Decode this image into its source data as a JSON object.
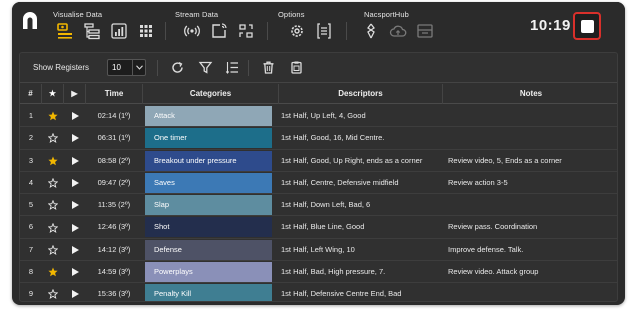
{
  "toolbar": {
    "groups": {
      "visualise": "Visualise Data",
      "stream": "Stream Data",
      "options": "Options",
      "hub": "NacsportHub"
    },
    "clock": "10:19",
    "icons": {
      "visualise": [
        "register-list-icon",
        "tree-list-icon",
        "chart-icon",
        "grid-icon"
      ],
      "stream": [
        "broadcast-icon",
        "stream-export-icon",
        "connect-icon"
      ],
      "options": [
        "settings-icon",
        "sliders-icon"
      ],
      "hub": [
        "share-icon",
        "cloud-upload-icon",
        "grid-upload-icon"
      ]
    },
    "accent_color": "#f2b700",
    "stop_color": "#d9302b"
  },
  "subbar": {
    "show_label": "Show Registers",
    "registers_value": "10"
  },
  "table": {
    "headers": {
      "num": "#",
      "star": "★",
      "play": "▶",
      "time": "Time",
      "categories": "Categories",
      "descriptors": "Descriptors",
      "notes": "Notes"
    },
    "rows": [
      {
        "num": "1",
        "starred": true,
        "time": "02:14 (1º)",
        "category": "Attack",
        "cat_color": "#8fa7b6",
        "descriptors": "1st Half, Up Left, 4, Good",
        "notes": ""
      },
      {
        "num": "2",
        "starred": false,
        "time": "06:31 (1º)",
        "category": "One timer",
        "cat_color": "#1d6e8a",
        "descriptors": "1st Half, Good, 16, Mid Centre.",
        "notes": ""
      },
      {
        "num": "3",
        "starred": true,
        "time": "08:58 (2º)",
        "category": "Breakout under pressure",
        "cat_color": "#2e4b8c",
        "descriptors": "1st Half, Good, Up Right, ends as a corner",
        "notes": "Review video, 5, Ends as a corner"
      },
      {
        "num": "4",
        "starred": false,
        "time": "09:47 (2º)",
        "category": "Saves",
        "cat_color": "#3c79b5",
        "descriptors": "1st Half, Centre, Defensive midfield",
        "notes": "Review action 3-5"
      },
      {
        "num": "5",
        "starred": false,
        "time": "11:35 (2º)",
        "category": "Slap",
        "cat_color": "#5e8da0",
        "descriptors": "1st Half, Down Left, Bad, 6",
        "notes": ""
      },
      {
        "num": "6",
        "starred": false,
        "time": "12:46 (3º)",
        "category": "Shot",
        "cat_color": "#232e4d",
        "descriptors": "1st Half, Blue Line, Good",
        "notes": "Review pass. Coordination"
      },
      {
        "num": "7",
        "starred": false,
        "time": "14:12 (3º)",
        "category": "Defense",
        "cat_color": "#4e5266",
        "descriptors": "1st Half, Left Wing, 10",
        "notes": "Improve defense. Talk."
      },
      {
        "num": "8",
        "starred": true,
        "time": "14:59 (3º)",
        "category": "Powerplays",
        "cat_color": "#8a90b8",
        "descriptors": "1st Half, Bad, High pressure, 7.",
        "notes": "Review video. Attack group"
      },
      {
        "num": "9",
        "starred": false,
        "time": "15:36 (3º)",
        "category": "Penalty Kill",
        "cat_color": "#3f7e92",
        "descriptors": "1st Half, Defensive Centre End, Bad",
        "notes": ""
      }
    ]
  }
}
